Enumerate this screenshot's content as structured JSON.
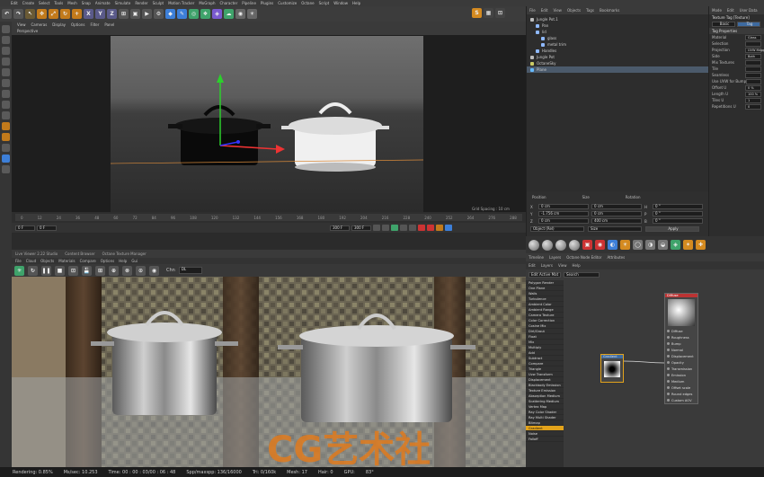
{
  "menu": [
    "Edit",
    "Create",
    "Select",
    "Tools",
    "Mesh",
    "Snap",
    "Animate",
    "Simulate",
    "Render",
    "Sculpt",
    "Motion Tracker",
    "MoGraph",
    "Character",
    "Pipeline",
    "Plugins",
    "Customize",
    "Octane",
    "Script",
    "Window",
    "Help"
  ],
  "menu2": [
    "RealFlow",
    "V-Ray",
    "X-Particles",
    "Octane",
    "Script",
    "Window",
    "Help"
  ],
  "toolbar": {
    "axis_x": "X",
    "axis_y": "Y",
    "axis_z": "Z"
  },
  "viewport": {
    "menu": [
      "View",
      "Cameras",
      "Display",
      "Options",
      "Filter",
      "Panel"
    ],
    "label": "Perspective",
    "grid_spacing": "Grid Spacing : 10 cm"
  },
  "timeline": {
    "ticks": [
      "0",
      "12",
      "24",
      "36",
      "48",
      "60",
      "72",
      "84",
      "96",
      "108",
      "120",
      "132",
      "144",
      "156",
      "168",
      "180",
      "192",
      "204",
      "216",
      "228",
      "240",
      "252",
      "264",
      "276",
      "288"
    ],
    "start": "0 F",
    "current": "0 F",
    "end": "300 F",
    "end2": "300 F"
  },
  "objects": {
    "menu": [
      "File",
      "Edit",
      "View",
      "Objects",
      "Tags",
      "Bookmarks"
    ],
    "rows": [
      {
        "name": "Jungle Pot.1",
        "color": "#bbbbbb"
      },
      {
        "name": "Pan",
        "color": "#8fb9ff"
      },
      {
        "name": "lid",
        "color": "#8fb9ff"
      },
      {
        "name": "glass",
        "color": "#8fb9ff"
      },
      {
        "name": "metal trim",
        "color": "#8fb9ff"
      },
      {
        "name": "Handles",
        "color": "#8fb9ff"
      },
      {
        "name": "Jungle Pot",
        "color": "#bbbbbb"
      },
      {
        "name": "OctaneSky",
        "color": "#cccc66"
      },
      {
        "name": "Plane",
        "color": "#66bbff"
      }
    ]
  },
  "coords": {
    "headers": [
      "Position",
      "Size",
      "Rotation"
    ],
    "rows": [
      [
        "X",
        "0 cm",
        "0 cm",
        "H",
        "0 °"
      ],
      [
        "Y",
        "-1.756 cm",
        "0 cm",
        "P",
        "0 °"
      ],
      [
        "Z",
        "0 cm",
        "400 cm",
        "B",
        "0 °"
      ]
    ],
    "mode": "Object (Rel)",
    "size_mode": "Size",
    "apply": "Apply"
  },
  "attributes": {
    "tabs": [
      "Mode",
      "Edit",
      "User Data"
    ],
    "title": "Texture Tag [Texture]",
    "tabs2": [
      "Basic",
      "Tag"
    ],
    "section": "Tag Properties",
    "rows": [
      [
        "Material",
        "Glass"
      ],
      [
        "Selection",
        ""
      ],
      [
        "Projection",
        "UVW Mapping"
      ],
      [
        "Side",
        "Both"
      ],
      [
        "Mix Textures",
        ""
      ],
      [
        "Tile",
        ""
      ],
      [
        "Seamless",
        ""
      ],
      [
        "Use UVW for Bump",
        ""
      ],
      [
        "Offset U",
        "0 %"
      ],
      [
        "Length U",
        "100 %"
      ],
      [
        "Tiles U",
        "1"
      ],
      [
        "Repetitions U",
        "0"
      ]
    ]
  },
  "render_view": {
    "tabs": [
      "Live Viewer 2.22 Studio",
      "Content Browser",
      "Octane Texture Manager"
    ],
    "menu": [
      "File",
      "Cloud",
      "Objects",
      "Materials",
      "Compare",
      "Options",
      "Help",
      "Gui"
    ],
    "channel": "Chn",
    "channel_val": "DL",
    "watermark": "CG艺术社"
  },
  "status": {
    "rendering": "Rendering: 0.85%",
    "ms_sec": "Ms/sec: 10.253",
    "time": "Time: 00 : 00 : 03/00 : 06 : 48",
    "spp": "Spp/maxspp: 136/16000",
    "tri": "Tri: 0/160k",
    "mesh": "Mesh: 17",
    "hair": "Hair: 0",
    "gpu": "GPU:",
    "gpu_val": "83°"
  },
  "node_editor": {
    "tabs": [
      "Timeline",
      "Layers",
      "Octane Node Editor",
      "Attributes"
    ],
    "menu": [
      "Edit",
      "Layers",
      "View",
      "Help"
    ],
    "search": "Edit Active Mat",
    "search2": "Search",
    "items": [
      "Polygon Render",
      "One Plane",
      "Walls",
      "Turbulence",
      "Ambient Color",
      "Ambient Range",
      "Camera Texture",
      "Color Correction",
      "Cosine Mix",
      "Dirt/Grout",
      "Float",
      "Mix",
      "Multiply",
      "Add",
      "Subtract",
      "Compare",
      "Triangle",
      "Uvw Transform",
      "Displacement",
      "Blackbody Emission",
      "Texture Emission",
      "Absorption Medium",
      "Scattering Medium",
      "Vertex Map",
      "Ray Color Shader",
      "Ray Multi Shader",
      "Bitmap",
      "Gradient",
      "Noise",
      "Falloff"
    ],
    "highlight_index": 27,
    "node_small": "Gradient",
    "node_big": "Diffuse",
    "ports": [
      "Diffuse",
      "Roughness",
      "Bump",
      "Normal",
      "Displacement",
      "Opacity",
      "Transmission",
      "Emission",
      "Medium",
      "Offset scale",
      "Round edges",
      "Custom AOV"
    ]
  }
}
